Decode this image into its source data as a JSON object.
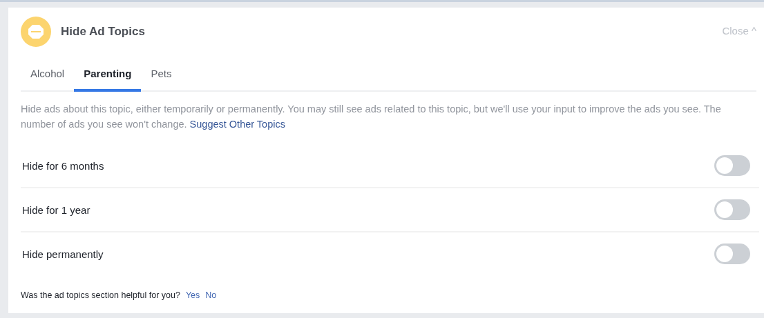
{
  "header": {
    "title": "Hide Ad Topics",
    "close": "Close ^"
  },
  "tabs": [
    {
      "label": "Alcohol",
      "selected": false
    },
    {
      "label": "Parenting",
      "selected": true
    },
    {
      "label": "Pets",
      "selected": false
    }
  ],
  "description": {
    "text": "Hide ads about this topic, either temporarily or permanently. You may still see ads related to this topic, but we'll use your input to improve the ads you see. The number of ads you see won't change.",
    "link": "Suggest Other Topics"
  },
  "options": [
    {
      "label": "Hide for 6 months",
      "on": false
    },
    {
      "label": "Hide for 1 year",
      "on": false
    },
    {
      "label": "Hide permanently",
      "on": false
    }
  ],
  "feedback": {
    "question": "Was the ad topics section helpful for you?",
    "answers": [
      "Yes",
      "No"
    ]
  }
}
